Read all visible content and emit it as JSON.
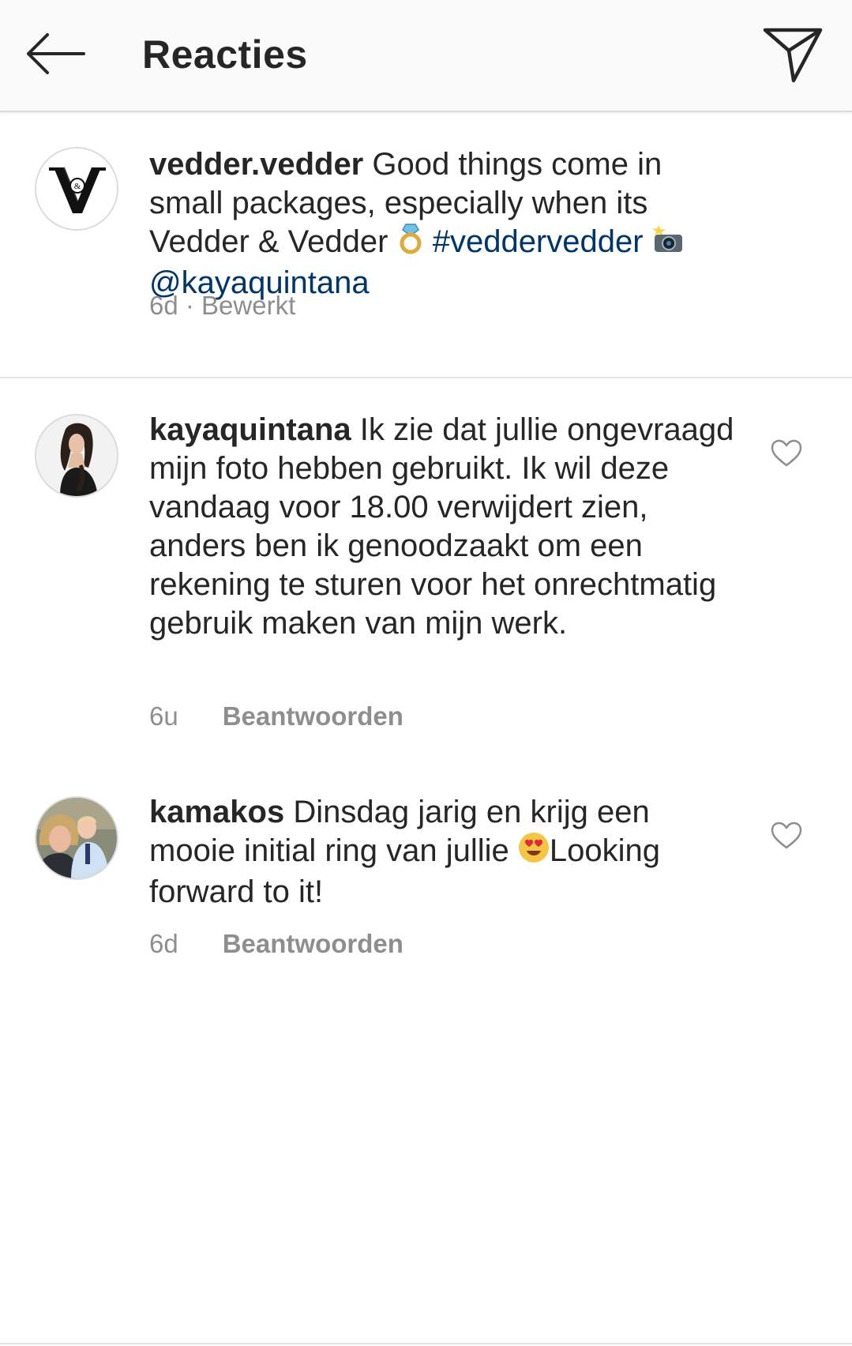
{
  "header": {
    "title": "Reacties"
  },
  "caption": {
    "username": "vedder.vedder",
    "text_1": " Good things come in small packages, especially when its Vedder & Vedder ",
    "hashtag": "#veddervedder",
    "mention": "@kayaquintana",
    "time": "6d",
    "edited": " · Bewerkt",
    "emojis": [
      "ring-emoji",
      "camera-flash-emoji"
    ]
  },
  "comments": [
    {
      "username": "kayaquintana",
      "text": " Ik zie dat jullie ongevraagd mijn foto hebben gebruikt. Ik wil deze vandaag voor 18.00 verwijdert zien, anders ben ik genoodzaakt om een rekening te sturen voor het onrechtmatig gebruik maken van mijn werk.",
      "time": "6u",
      "reply_label": "Beantwoorden"
    },
    {
      "username": "kamakos",
      "text_1": " Dinsdag jarig en krijg een mooie initial ring  van jullie ",
      "text_2": "Looking forward to it!",
      "time": "6d",
      "reply_label": "Beantwoorden",
      "emoji": "heart-eyes-emoji"
    }
  ],
  "colors": {
    "header_bg": "#fafafa",
    "text": "#262626",
    "secondary": "#8e8e8e",
    "link": "#003569",
    "divider": "#dbdbdb"
  }
}
